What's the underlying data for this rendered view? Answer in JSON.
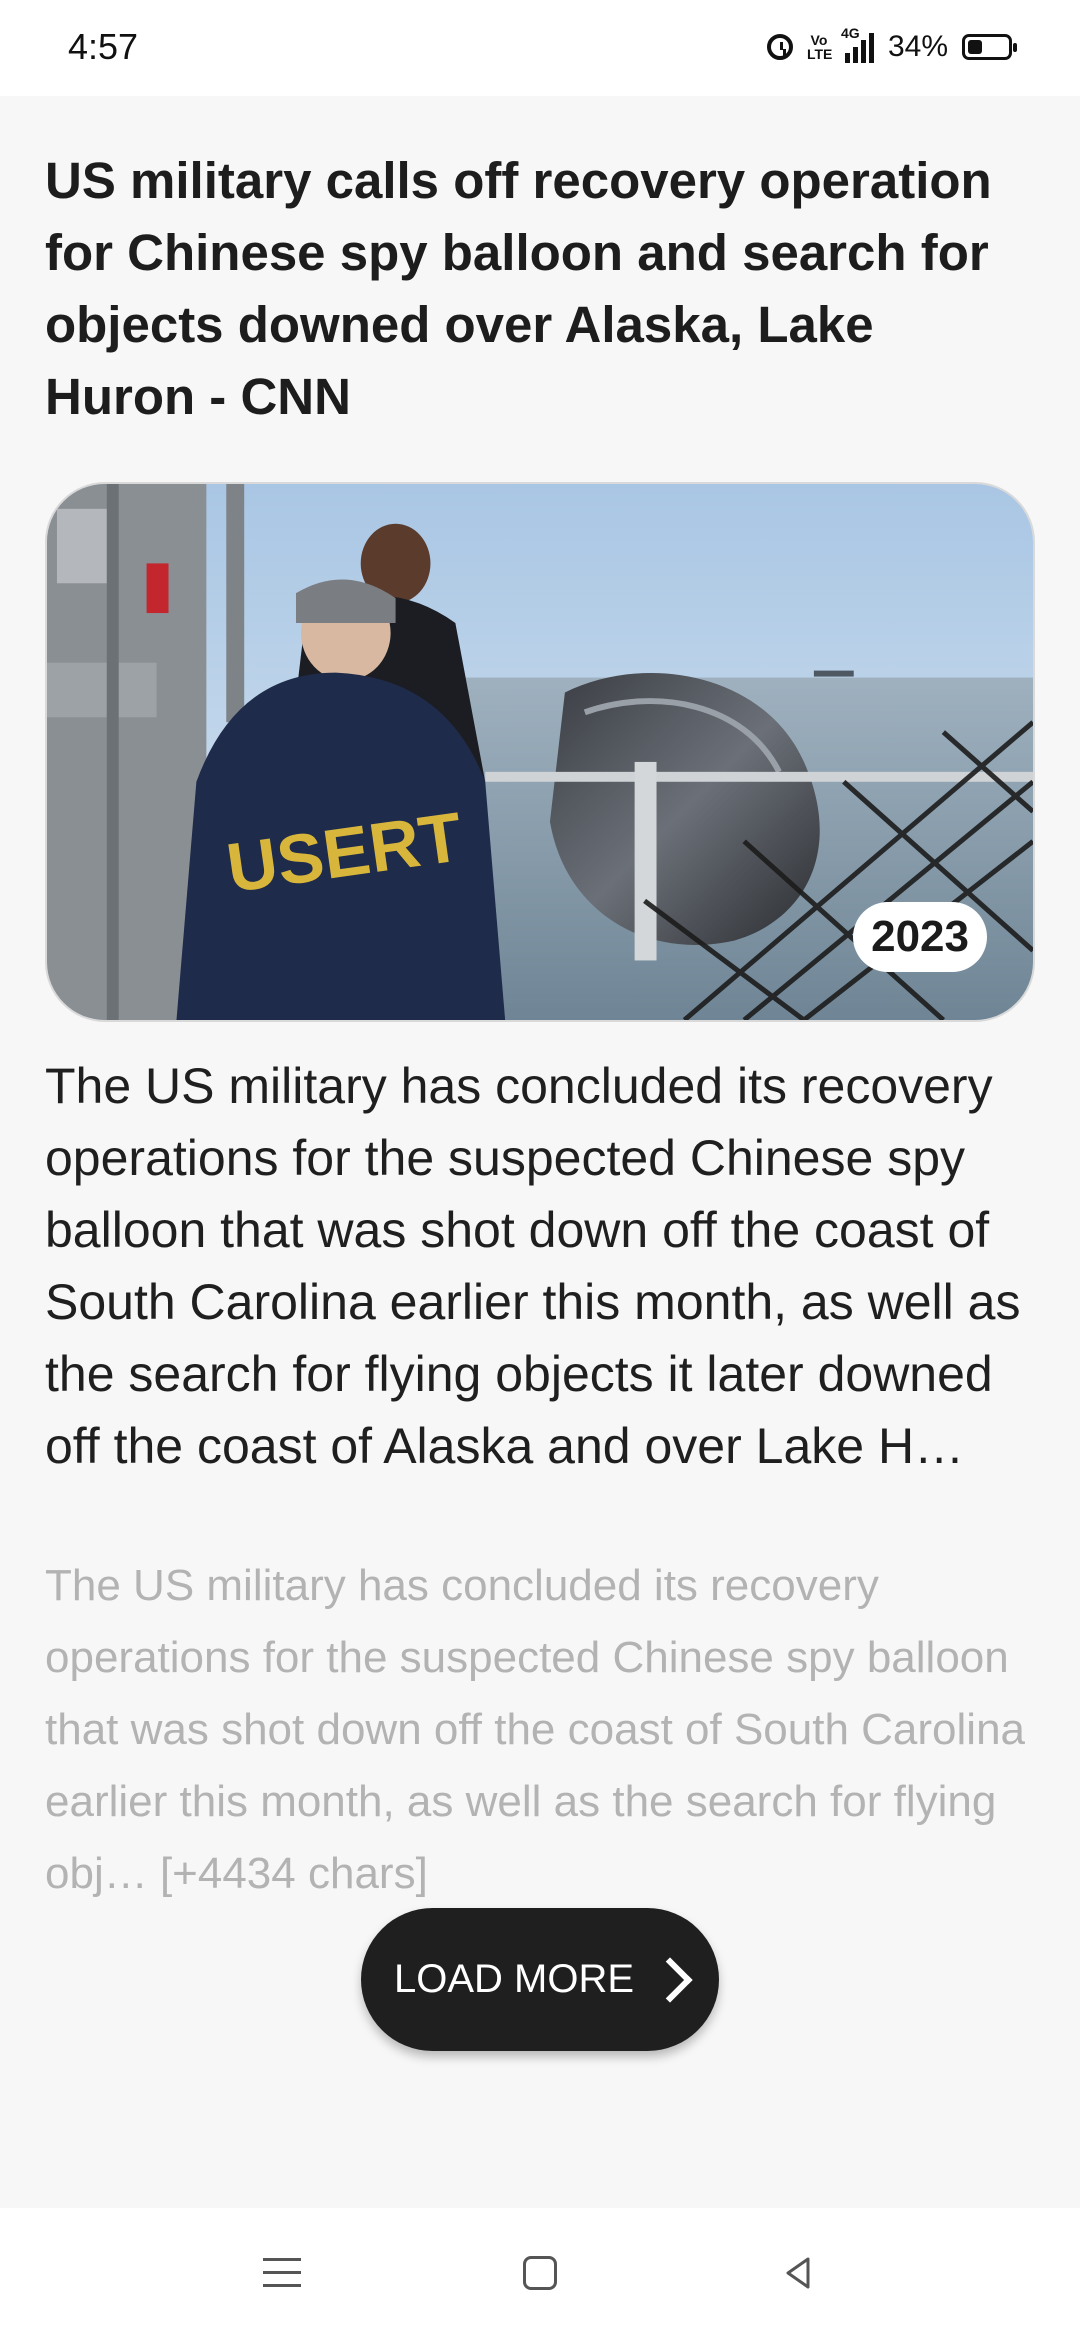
{
  "status_bar": {
    "time": "4:57",
    "volte": "Vo LTE",
    "network": "4G",
    "battery": "34%",
    "icons": [
      "alarm-icon",
      "volte-icon",
      "signal-icon",
      "battery-icon"
    ]
  },
  "article": {
    "title": "US military calls off recovery operation for Chinese spy balloon and search for objects downed over Alaska, Lake Huron - CNN",
    "image_badge": "2023",
    "image_jacket_text": "USERT",
    "summary": "The US military has concluded its recovery operations for the suspected Chinese spy balloon that was shot down off the coast of South Carolina earlier this month, as well as the search for flying objects it later downed off the coast of Alaska and over Lake H…",
    "content_preview": "The US military has concluded its recovery operations for the suspected Chinese spy balloon that was shot down off the coast of South Carolina earlier this month, as well as the search for flying obj… [+4434 chars]"
  },
  "load_more": {
    "label": "LOAD MORE",
    "icon": "chevron-right-icon"
  },
  "nav_bar": {
    "icons": [
      "menu-icon",
      "home-icon",
      "back-icon"
    ]
  }
}
